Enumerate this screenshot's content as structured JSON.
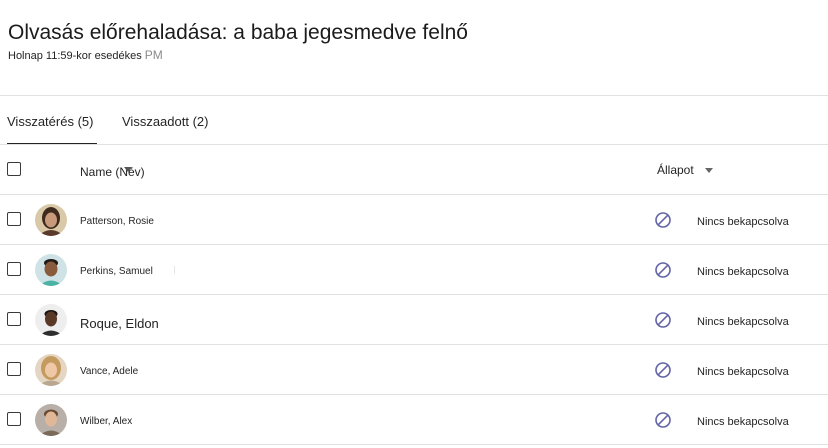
{
  "assignment": {
    "title": "Olvasás előrehaladása: a baba jegesmedve felnő",
    "due": "Holnap 11:59-kor esedékes",
    "due_suffix": "PM"
  },
  "tabs": [
    {
      "label": "Visszatérés (5)",
      "selected": true
    },
    {
      "label": "Visszaadott (2)",
      "selected": false
    }
  ],
  "table": {
    "name_header": "Name (Név)",
    "status_header": "Állapot",
    "rows": [
      {
        "name": "Patterson, Rosie",
        "status": "Nincs bekapcsolva",
        "avatar": "avatar-rosie"
      },
      {
        "name": "Perkins, Samuel",
        "status": "Nincs bekapcsolva",
        "avatar": "avatar-samuel"
      },
      {
        "name": "Roque, Eldon",
        "status": "Nincs bekapcsolva",
        "avatar": "avatar-eldon"
      },
      {
        "name": "Vance, Adele",
        "status": "Nincs bekapcsolva",
        "avatar": "avatar-adele"
      },
      {
        "name": "Wilber, Alex",
        "status": "Nincs bekapcsolva",
        "avatar": "avatar-alex"
      }
    ]
  },
  "colors": {
    "status_icon": "#6264a7",
    "divider": "#e1e1e1",
    "text": "#242424"
  },
  "icons": {
    "status": "not-submitted-icon",
    "sort": "sort-arrow-icon",
    "filter": "chevron-down-icon"
  }
}
